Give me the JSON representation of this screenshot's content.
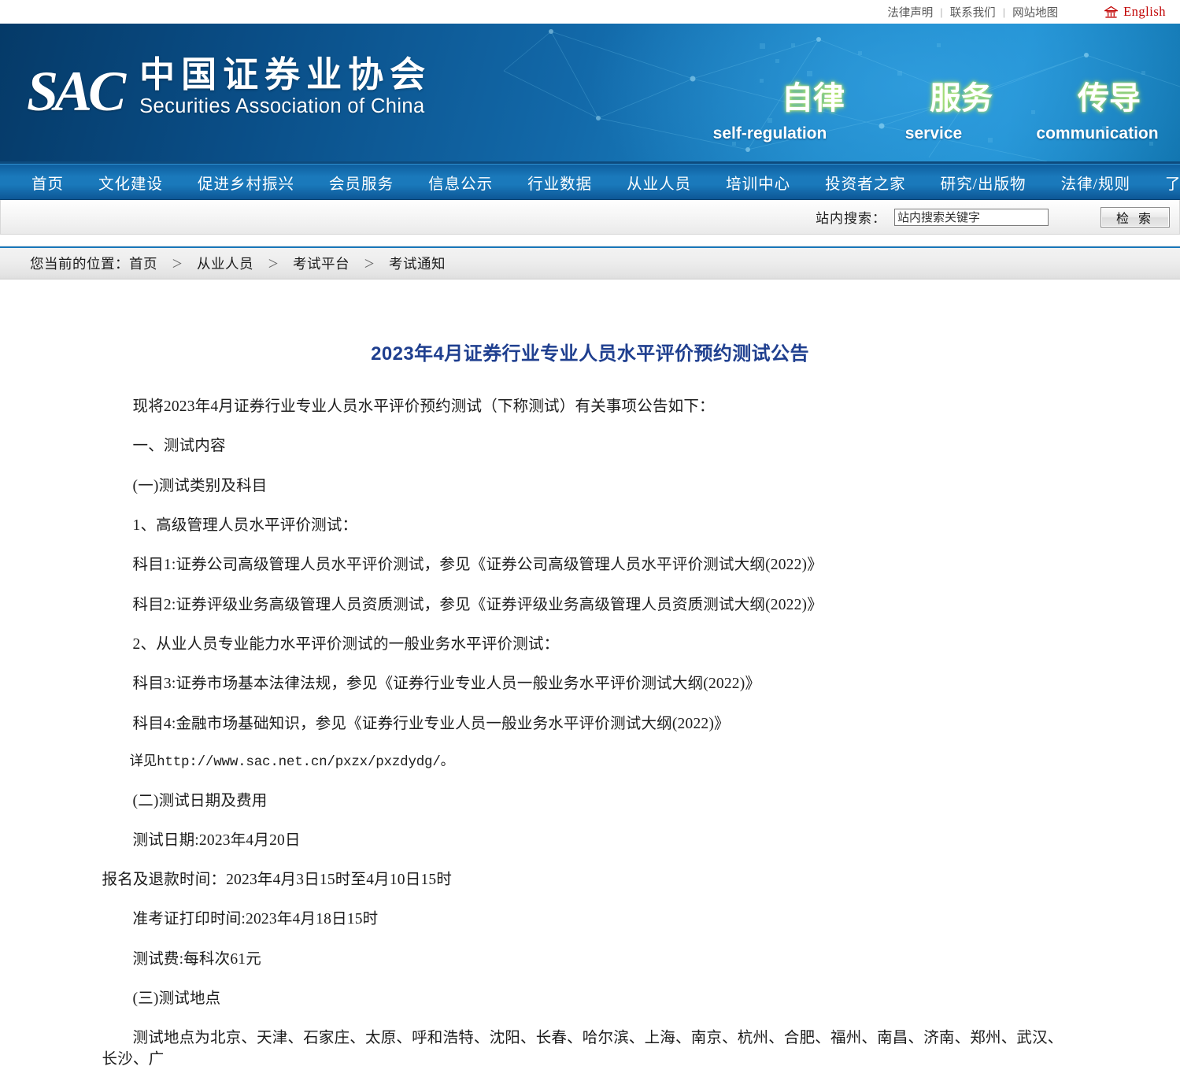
{
  "topbar": {
    "links": [
      "法律声明",
      "联系我们",
      "网站地图"
    ],
    "separator": "|",
    "english_label": "English",
    "home_icon": "home-icon"
  },
  "banner": {
    "logo_mark": "SAC",
    "logo_zh": "中国证券业协会",
    "logo_en": "Securities Association of China",
    "slogan_zh": [
      "自律",
      "服务",
      "传导"
    ],
    "slogan_en": [
      "self-regulation",
      "service",
      "communication"
    ]
  },
  "mainnav": {
    "items": [
      "首页",
      "文化建设",
      "促进乡村振兴",
      "会员服务",
      "信息公示",
      "行业数据",
      "从业人员",
      "培训中心",
      "投资者之家",
      "研究/出版物",
      "法律/规则",
      "了解协会"
    ]
  },
  "search": {
    "label": "站内搜索：",
    "value": "站内搜索关键字",
    "placeholder": "站内搜索关键字",
    "button_label": "检 索"
  },
  "breadcrumb": {
    "prefix": "您当前的位置：",
    "separator": "＞",
    "items": [
      "首页",
      "从业人员",
      "考试平台",
      "考试通知"
    ]
  },
  "article": {
    "title": "2023年4月证券行业专业人员水平评价预约测试公告",
    "paragraphs": [
      "现将2023年4月证券行业专业人员水平评价预约测试（下称测试）有关事项公告如下：",
      "一、测试内容",
      "(一)测试类别及科目",
      "1、高级管理人员水平评价测试：",
      "科目1:证券公司高级管理人员水平评价测试，参见《证券公司高级管理人员水平评价测试大纲(2022)》",
      "科目2:证券评级业务高级管理人员资质测试，参见《证券评级业务高级管理人员资质测试大纲(2022)》",
      "2、从业人员专业能力水平评价测试的一般业务水平评价测试：",
      "科目3:证券市场基本法律法规，参见《证券行业专业人员一般业务水平评价测试大纲(2022)》",
      "科目4:金融市场基础知识，参见《证券行业专业人员一般业务水平评价测试大纲(2022)》",
      "详见http://www.sac.net.cn/pxzx/pxzdydg/。",
      "(二)测试日期及费用",
      "测试日期:2023年4月20日",
      "报名及退款时间：2023年4月3日15时至4月10日15时",
      "准考证打印时间:2023年4月18日15时",
      "测试费:每科次61元",
      "(三)测试地点",
      "测试地点为北京、天津、石家庄、太原、呼和浩特、沈阳、长春、哈尔滨、上海、南京、杭州、合肥、福州、南昌、济南、郑州、武汉、长沙、广"
    ]
  },
  "colors": {
    "brand_blue": "#1a79bb",
    "banner_dark": "#053a68",
    "title_blue": "#1f3f8f",
    "english_red": "#c00000"
  }
}
